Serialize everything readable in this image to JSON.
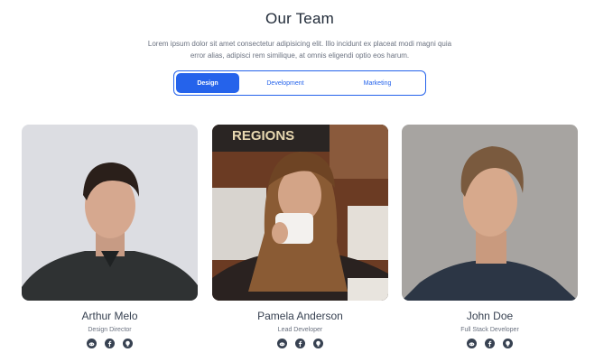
{
  "page": {
    "title": "Our Team",
    "intro": "Lorem ipsum dolor sit amet consectetur adipisicing elit. Illo incidunt ex placeat modi magni quia error alias, adipisci rem similique, at omnis eligendi optio eos harum."
  },
  "tabs": [
    {
      "label": "Design",
      "active": true
    },
    {
      "label": "Development",
      "active": false
    },
    {
      "label": "Marketing",
      "active": false
    }
  ],
  "members": [
    {
      "name": "Arthur Melo",
      "role": "Design Director",
      "socials": [
        "reddit-icon",
        "facebook-icon",
        "github-icon"
      ]
    },
    {
      "name": "Pamela Anderson",
      "role": "Lead Developer",
      "photo_sign": "REGIONS",
      "socials": [
        "reddit-icon",
        "facebook-icon",
        "github-icon"
      ]
    },
    {
      "name": "John Doe",
      "role": "Full Stack Developer",
      "socials": [
        "reddit-icon",
        "facebook-icon",
        "github-icon"
      ]
    }
  ],
  "colors": {
    "accent": "#2563eb",
    "text_dark": "#1f2937",
    "text_muted": "#6b7280",
    "icon": "#374151"
  }
}
